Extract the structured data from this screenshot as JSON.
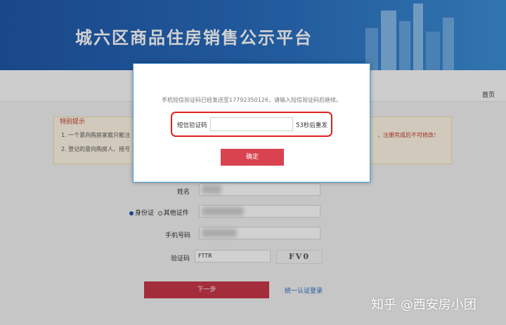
{
  "header": {
    "title": "城六区商品住房销售公示平台"
  },
  "nav": {
    "home": "首页"
  },
  "notice": {
    "title": "特别提示",
    "line1": "1. 一个意向购房家庭只能注",
    "line2": "2. 登记的意向购房人、摇号",
    "line1_tail": "，注册完成后不可修改！"
  },
  "form": {
    "name_label": "姓名",
    "id_type": {
      "option1": "身份证",
      "option2": "其他证件",
      "selected": "身份证"
    },
    "phone_label": "手机号码",
    "captcha_label": "验证码",
    "captcha_value": "FTTR",
    "captcha_image_text": "FV0",
    "next_button": "下一步",
    "unified_login_link": "统一认证登录"
  },
  "modal": {
    "message": "手机短信验证码已经发送至17792350126，请输入短信验证码后继续。",
    "sms_label": "短信验证码",
    "sms_value": "",
    "resend_text": "53秒后重发",
    "confirm_button": "确定"
  },
  "watermark": "知乎 @西安房小团",
  "colors": {
    "banner": "#1f57a8",
    "primary_button": "#c9374a",
    "highlight_border": "#e02020",
    "link": "#2a6fc0"
  }
}
